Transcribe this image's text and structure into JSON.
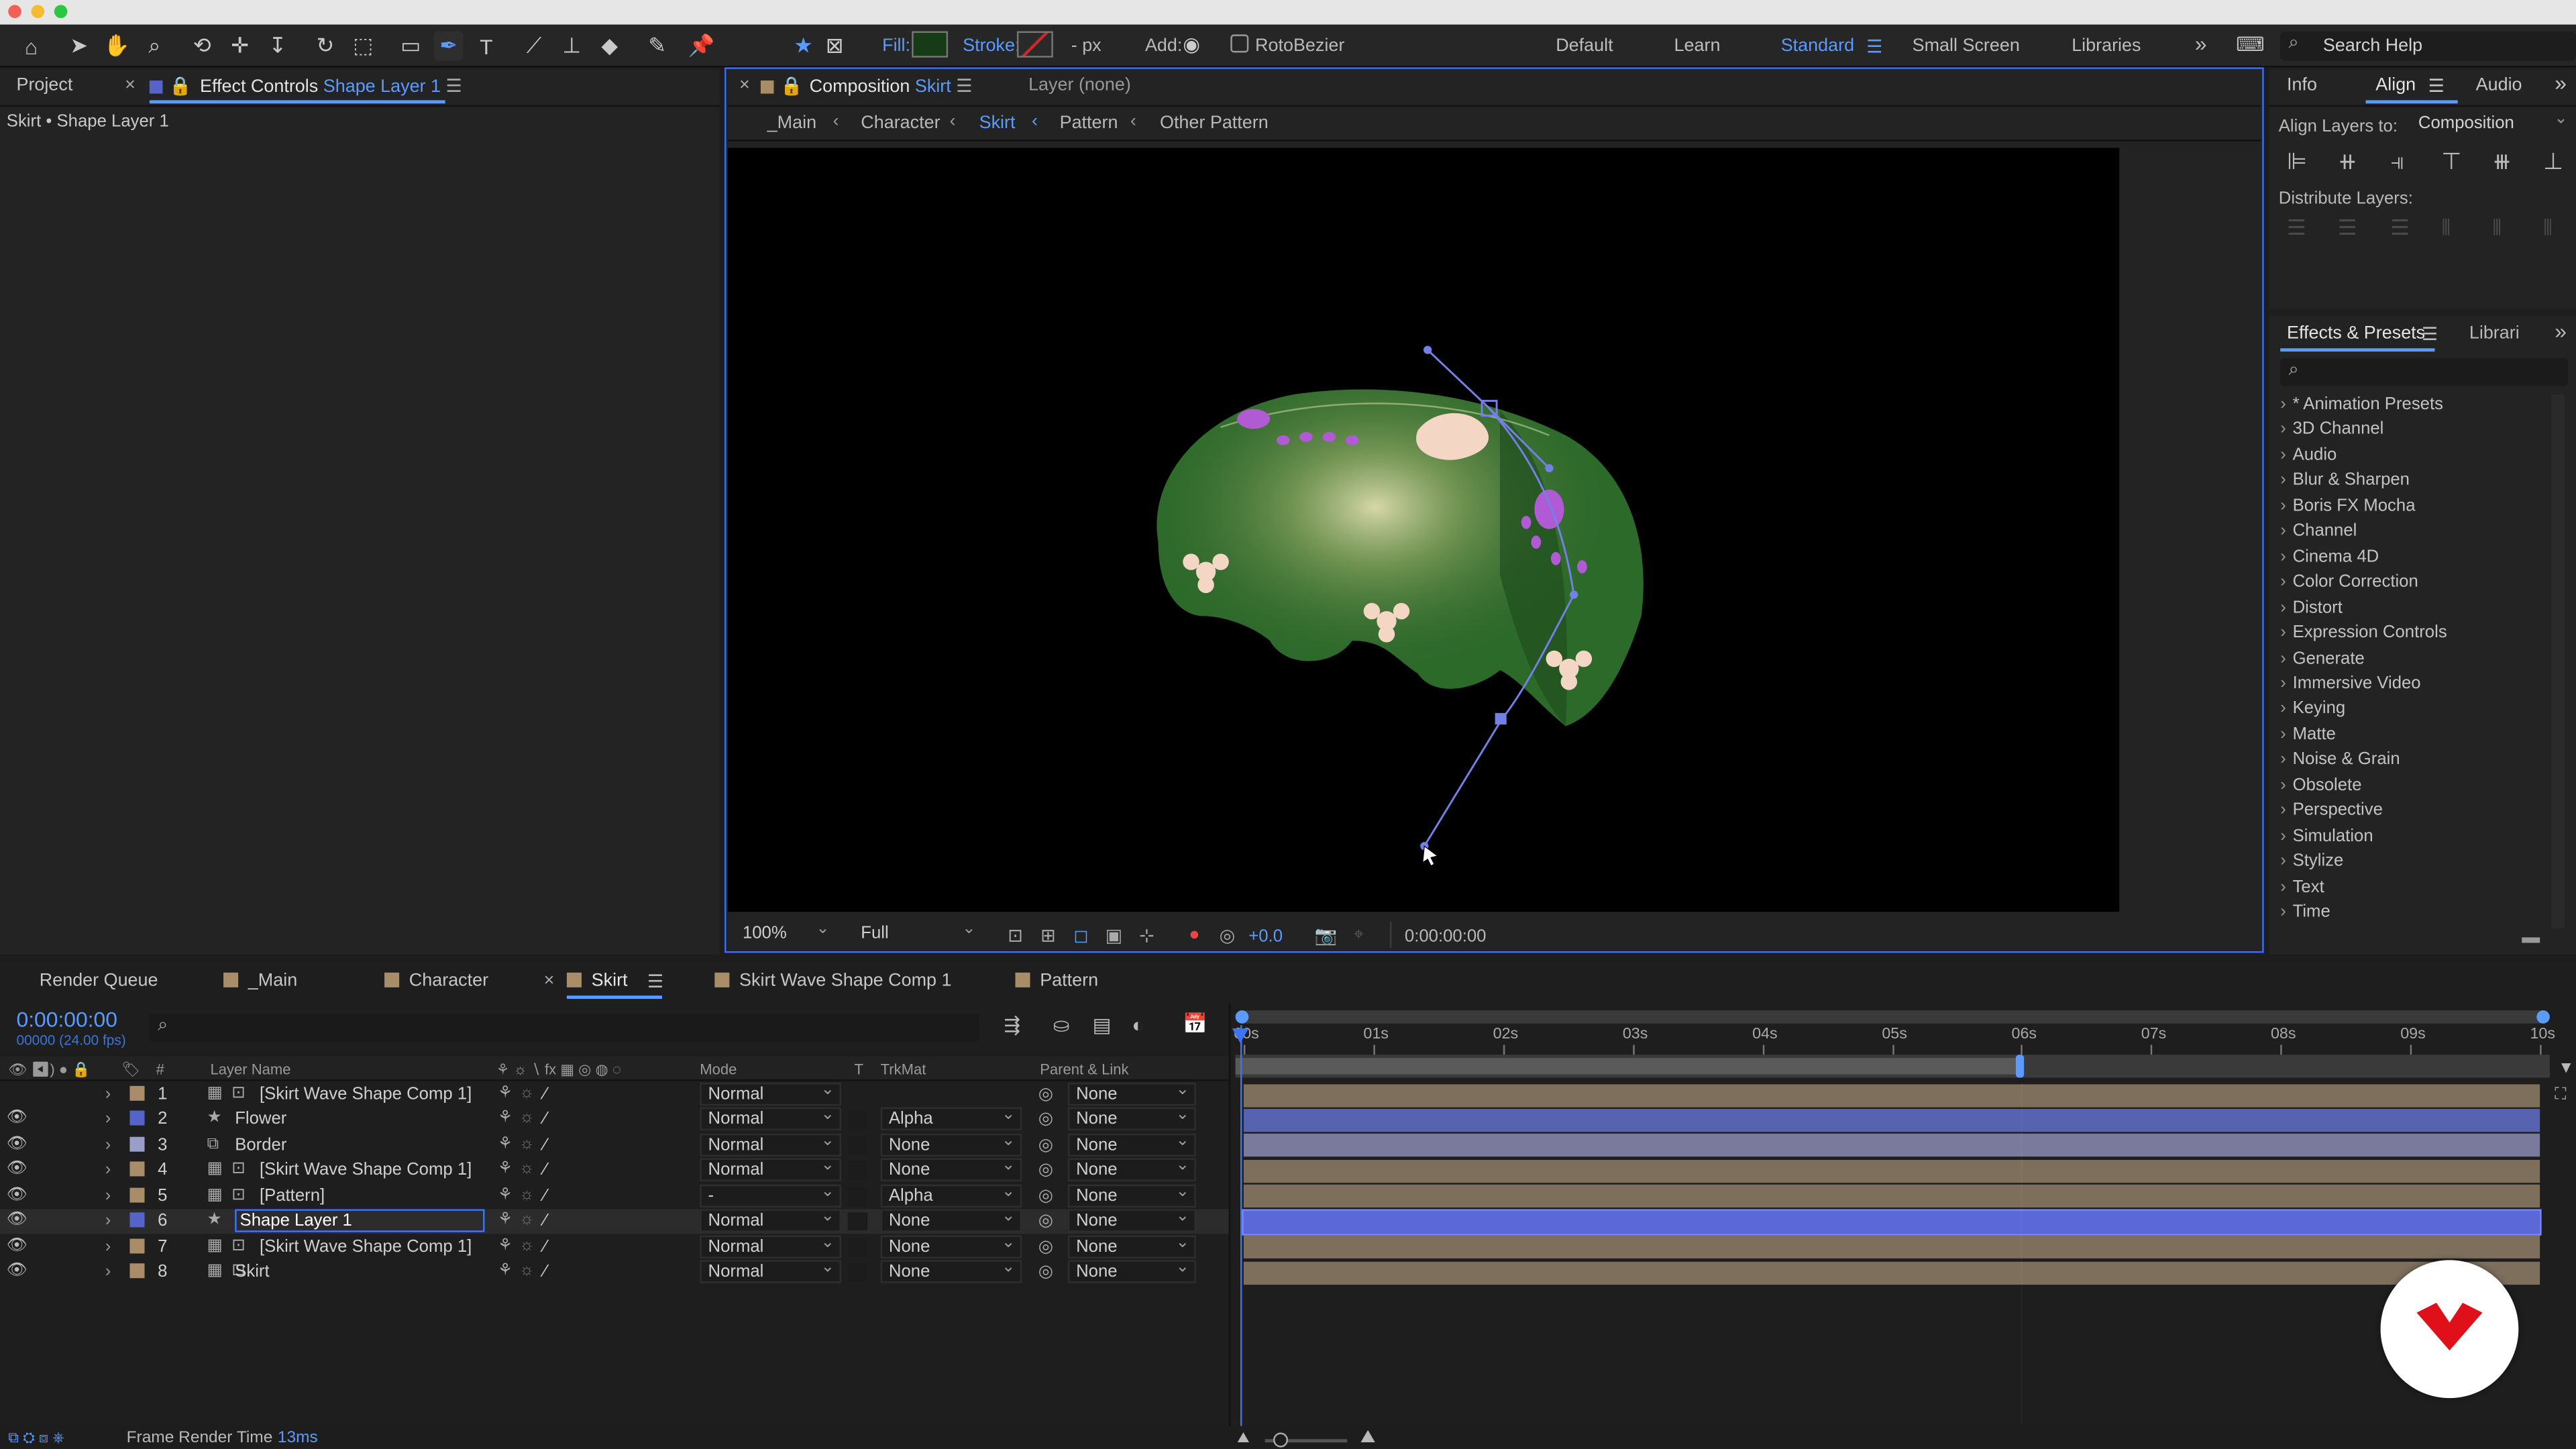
{
  "toolbar": {
    "fill_label": "Fill:",
    "stroke_label": "Stroke:",
    "stroke_width": "- px",
    "add_label": "Add:",
    "rotobezier_label": "RotoBezier",
    "workspaces": [
      "Default",
      "Learn",
      "Standard",
      "Small Screen",
      "Libraries"
    ],
    "active_workspace": "Standard",
    "search_placeholder": "Search Help",
    "icons": [
      "home-icon",
      "selection-icon",
      "hand-icon",
      "zoom-icon",
      "orbit-camera-icon",
      "pan-camera-icon",
      "dolly-camera-icon",
      "rotation-icon",
      "pan-behind-icon",
      "rectangle-icon",
      "pen-icon",
      "type-icon",
      "brush-icon",
      "clone-stamp-icon",
      "eraser-icon",
      "roto-brush-icon",
      "puppet-pin-icon"
    ]
  },
  "left_panel": {
    "tab_project": "Project",
    "tab_effect_controls": "Effect Controls",
    "effect_controls_layer": "Shape Layer 1",
    "subtitle": "Skirt • Shape Layer 1"
  },
  "comp_panel": {
    "tab_label": "Composition",
    "comp_name": "Skirt",
    "layer_label": "Layer (none)",
    "breadcrumbs": [
      "_Main",
      "Character",
      "Skirt",
      "Pattern",
      "Other Pattern"
    ],
    "active_breadcrumb": "Skirt",
    "zoom": "100%",
    "resolution": "Full",
    "exposure": "+0.0",
    "timecode": "0:00:00:00"
  },
  "right_panel": {
    "tabs": [
      "Info",
      "Align",
      "Audio"
    ],
    "active_tab": "Align",
    "align_layers_to_label": "Align Layers to:",
    "align_layers_to_value": "Composition",
    "distribute_label": "Distribute Layers:",
    "effects_tab": "Effects & Presets",
    "libraries_tab": "Librari",
    "effects_search_placeholder": "",
    "effects_categories": [
      "* Animation Presets",
      "3D Channel",
      "Audio",
      "Blur & Sharpen",
      "Boris FX Mocha",
      "Channel",
      "Cinema 4D",
      "Color Correction",
      "Distort",
      "Expression Controls",
      "Generate",
      "Immersive Video",
      "Keying",
      "Matte",
      "Noise & Grain",
      "Obsolete",
      "Perspective",
      "Simulation",
      "Stylize",
      "Text",
      "Time"
    ]
  },
  "timeline": {
    "tabs": [
      {
        "label": "Render Queue",
        "color": ""
      },
      {
        "label": "_Main",
        "color": "#a88d68"
      },
      {
        "label": "Character",
        "color": "#a88d68"
      },
      {
        "label": "Skirt",
        "color": "#a88d68"
      },
      {
        "label": "Skirt Wave Shape Comp 1",
        "color": "#a88d68"
      },
      {
        "label": "Pattern",
        "color": "#a88d68"
      }
    ],
    "active_tab": "Skirt",
    "current_time": "0:00:00:00",
    "frame_info": "00000 (24.00 fps)",
    "search_placeholder": "",
    "columns": {
      "layer_name": "Layer Name",
      "number": "#",
      "mode": "Mode",
      "t": "T",
      "trkmat": "TrkMat",
      "parent": "Parent & Link"
    },
    "ruler_ticks": [
      "00s",
      "01s",
      "02s",
      "03s",
      "04s",
      "05s",
      "06s",
      "07s",
      "08s",
      "09s",
      "10s"
    ],
    "work_area_end_fraction": 0.6,
    "layers": [
      {
        "num": "1",
        "name": "[Skirt Wave Shape Comp 1]",
        "color": "#a88d68",
        "type": "comp",
        "mode": "Normal",
        "trkmat": "",
        "parent": "None",
        "visible": false,
        "bar": "#7d6f5c"
      },
      {
        "num": "2",
        "name": "Flower",
        "color": "#5663c9",
        "type": "shape",
        "mode": "Normal",
        "trkmat": "Alpha",
        "parent": "None",
        "visible": true,
        "bar": "#5762b0"
      },
      {
        "num": "3",
        "name": "Border",
        "color": "#9a9ec9",
        "type": "footage",
        "mode": "Normal",
        "trkmat": "None",
        "parent": "None",
        "visible": true,
        "bar": "#7a7b9c"
      },
      {
        "num": "4",
        "name": "[Skirt Wave Shape Comp 1]",
        "color": "#a88d68",
        "type": "comp",
        "mode": "Normal",
        "trkmat": "None",
        "parent": "None",
        "visible": true,
        "bar": "#7d6f5c"
      },
      {
        "num": "5",
        "name": "[Pattern]",
        "color": "#a88d68",
        "type": "comp",
        "mode": "-",
        "trkmat": "Alpha",
        "parent": "None",
        "visible": true,
        "bar": "#7d6f5c"
      },
      {
        "num": "6",
        "name": "Shape Layer 1",
        "color": "#5663c9",
        "type": "shape",
        "mode": "Normal",
        "trkmat": "None",
        "parent": "None",
        "visible": true,
        "bar": "#5b68d8"
      },
      {
        "num": "7",
        "name": "[Skirt Wave Shape Comp 1]",
        "color": "#a88d68",
        "type": "comp",
        "mode": "Normal",
        "trkmat": "None",
        "parent": "None",
        "visible": true,
        "bar": "#7d6f5c"
      },
      {
        "num": "8",
        "name": "Skirt",
        "color": "#a88d68",
        "type": "comp",
        "mode": "Normal",
        "trkmat": "None",
        "parent": "None",
        "visible": true,
        "bar": "#7d6f5c"
      }
    ],
    "selected_layer": "6",
    "footer_label": "Frame Render Time",
    "footer_value": "13ms"
  }
}
